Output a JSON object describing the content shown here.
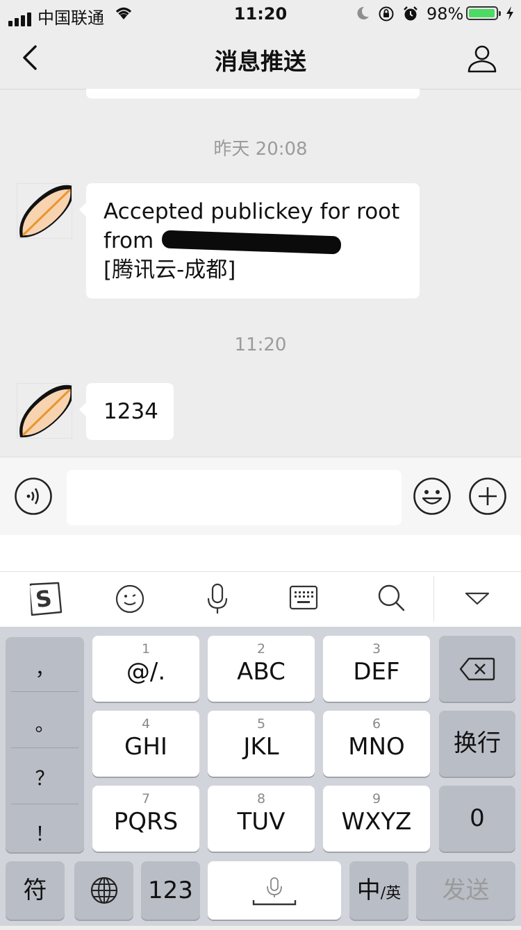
{
  "status_bar": {
    "carrier": "中国联通",
    "time": "11:20",
    "battery_percent": "98%",
    "battery_level": 0.98
  },
  "nav": {
    "title": "消息推送",
    "back_icon": "chevron-left-icon",
    "profile_icon": "person-icon"
  },
  "chat": {
    "messages": [
      {
        "time": "昨天 20:08",
        "line1": "Accepted publickey for root",
        "line2": "from",
        "line3": "[腾讯云-成都]"
      },
      {
        "time": "11:20",
        "text": "1234"
      }
    ]
  },
  "input_bar": {
    "value": "",
    "voice_icon": "voice-icon",
    "emoji_icon": "emoji-icon",
    "plus_icon": "plus-icon"
  },
  "ime_toolbar": {
    "icons": [
      "sogou-logo-icon",
      "emoticon-icon",
      "microphone-icon",
      "keyboard-icon",
      "search-icon",
      "collapse-keyboard-icon"
    ]
  },
  "keyboard": {
    "punctuation": [
      "，",
      "。",
      "？",
      "！"
    ],
    "keys": [
      {
        "num": "1",
        "label": "@/."
      },
      {
        "num": "2",
        "label": "ABC"
      },
      {
        "num": "3",
        "label": "DEF"
      },
      {
        "num": "4",
        "label": "GHI"
      },
      {
        "num": "5",
        "label": "JKL"
      },
      {
        "num": "6",
        "label": "MNO"
      },
      {
        "num": "7",
        "label": "PQRS"
      },
      {
        "num": "8",
        "label": "TUV"
      },
      {
        "num": "9",
        "label": "WXYZ"
      }
    ],
    "enter_label": "换行",
    "zero_label": "0",
    "symbol_label": "符",
    "number_label": "123",
    "lang_main": "中",
    "lang_sub": "/英",
    "send_label": "发送",
    "colors": {
      "send_text": "#9b9b9b",
      "key_bg": "#ffffff",
      "dark_key_bg": "#b9bdc5",
      "keyboard_bg": "#d1d4da"
    }
  }
}
